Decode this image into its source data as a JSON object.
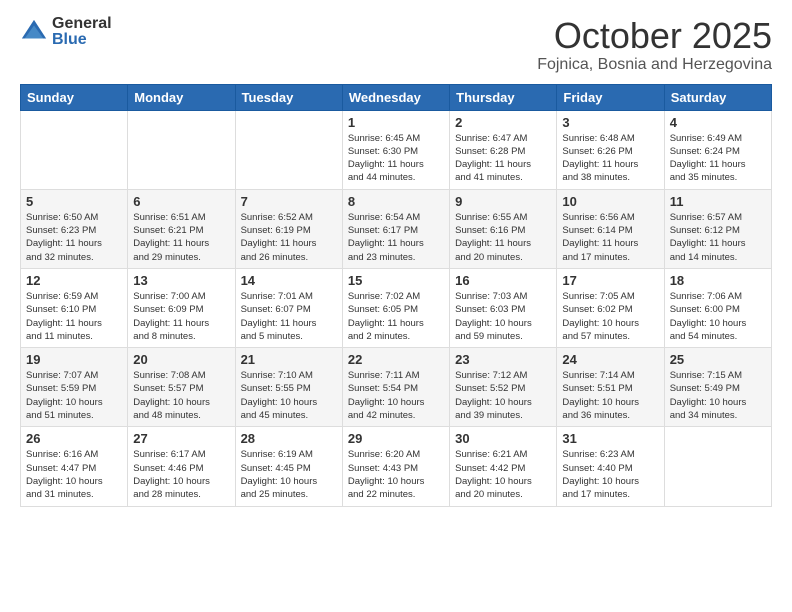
{
  "header": {
    "logo_general": "General",
    "logo_blue": "Blue",
    "month": "October 2025",
    "location": "Fojnica, Bosnia and Herzegovina"
  },
  "days_of_week": [
    "Sunday",
    "Monday",
    "Tuesday",
    "Wednesday",
    "Thursday",
    "Friday",
    "Saturday"
  ],
  "weeks": [
    [
      {
        "day": "",
        "info": ""
      },
      {
        "day": "",
        "info": ""
      },
      {
        "day": "",
        "info": ""
      },
      {
        "day": "1",
        "info": "Sunrise: 6:45 AM\nSunset: 6:30 PM\nDaylight: 11 hours\nand 44 minutes."
      },
      {
        "day": "2",
        "info": "Sunrise: 6:47 AM\nSunset: 6:28 PM\nDaylight: 11 hours\nand 41 minutes."
      },
      {
        "day": "3",
        "info": "Sunrise: 6:48 AM\nSunset: 6:26 PM\nDaylight: 11 hours\nand 38 minutes."
      },
      {
        "day": "4",
        "info": "Sunrise: 6:49 AM\nSunset: 6:24 PM\nDaylight: 11 hours\nand 35 minutes."
      }
    ],
    [
      {
        "day": "5",
        "info": "Sunrise: 6:50 AM\nSunset: 6:23 PM\nDaylight: 11 hours\nand 32 minutes."
      },
      {
        "day": "6",
        "info": "Sunrise: 6:51 AM\nSunset: 6:21 PM\nDaylight: 11 hours\nand 29 minutes."
      },
      {
        "day": "7",
        "info": "Sunrise: 6:52 AM\nSunset: 6:19 PM\nDaylight: 11 hours\nand 26 minutes."
      },
      {
        "day": "8",
        "info": "Sunrise: 6:54 AM\nSunset: 6:17 PM\nDaylight: 11 hours\nand 23 minutes."
      },
      {
        "day": "9",
        "info": "Sunrise: 6:55 AM\nSunset: 6:16 PM\nDaylight: 11 hours\nand 20 minutes."
      },
      {
        "day": "10",
        "info": "Sunrise: 6:56 AM\nSunset: 6:14 PM\nDaylight: 11 hours\nand 17 minutes."
      },
      {
        "day": "11",
        "info": "Sunrise: 6:57 AM\nSunset: 6:12 PM\nDaylight: 11 hours\nand 14 minutes."
      }
    ],
    [
      {
        "day": "12",
        "info": "Sunrise: 6:59 AM\nSunset: 6:10 PM\nDaylight: 11 hours\nand 11 minutes."
      },
      {
        "day": "13",
        "info": "Sunrise: 7:00 AM\nSunset: 6:09 PM\nDaylight: 11 hours\nand 8 minutes."
      },
      {
        "day": "14",
        "info": "Sunrise: 7:01 AM\nSunset: 6:07 PM\nDaylight: 11 hours\nand 5 minutes."
      },
      {
        "day": "15",
        "info": "Sunrise: 7:02 AM\nSunset: 6:05 PM\nDaylight: 11 hours\nand 2 minutes."
      },
      {
        "day": "16",
        "info": "Sunrise: 7:03 AM\nSunset: 6:03 PM\nDaylight: 10 hours\nand 59 minutes."
      },
      {
        "day": "17",
        "info": "Sunrise: 7:05 AM\nSunset: 6:02 PM\nDaylight: 10 hours\nand 57 minutes."
      },
      {
        "day": "18",
        "info": "Sunrise: 7:06 AM\nSunset: 6:00 PM\nDaylight: 10 hours\nand 54 minutes."
      }
    ],
    [
      {
        "day": "19",
        "info": "Sunrise: 7:07 AM\nSunset: 5:59 PM\nDaylight: 10 hours\nand 51 minutes."
      },
      {
        "day": "20",
        "info": "Sunrise: 7:08 AM\nSunset: 5:57 PM\nDaylight: 10 hours\nand 48 minutes."
      },
      {
        "day": "21",
        "info": "Sunrise: 7:10 AM\nSunset: 5:55 PM\nDaylight: 10 hours\nand 45 minutes."
      },
      {
        "day": "22",
        "info": "Sunrise: 7:11 AM\nSunset: 5:54 PM\nDaylight: 10 hours\nand 42 minutes."
      },
      {
        "day": "23",
        "info": "Sunrise: 7:12 AM\nSunset: 5:52 PM\nDaylight: 10 hours\nand 39 minutes."
      },
      {
        "day": "24",
        "info": "Sunrise: 7:14 AM\nSunset: 5:51 PM\nDaylight: 10 hours\nand 36 minutes."
      },
      {
        "day": "25",
        "info": "Sunrise: 7:15 AM\nSunset: 5:49 PM\nDaylight: 10 hours\nand 34 minutes."
      }
    ],
    [
      {
        "day": "26",
        "info": "Sunrise: 6:16 AM\nSunset: 4:47 PM\nDaylight: 10 hours\nand 31 minutes."
      },
      {
        "day": "27",
        "info": "Sunrise: 6:17 AM\nSunset: 4:46 PM\nDaylight: 10 hours\nand 28 minutes."
      },
      {
        "day": "28",
        "info": "Sunrise: 6:19 AM\nSunset: 4:45 PM\nDaylight: 10 hours\nand 25 minutes."
      },
      {
        "day": "29",
        "info": "Sunrise: 6:20 AM\nSunset: 4:43 PM\nDaylight: 10 hours\nand 22 minutes."
      },
      {
        "day": "30",
        "info": "Sunrise: 6:21 AM\nSunset: 4:42 PM\nDaylight: 10 hours\nand 20 minutes."
      },
      {
        "day": "31",
        "info": "Sunrise: 6:23 AM\nSunset: 4:40 PM\nDaylight: 10 hours\nand 17 minutes."
      },
      {
        "day": "",
        "info": ""
      }
    ]
  ]
}
